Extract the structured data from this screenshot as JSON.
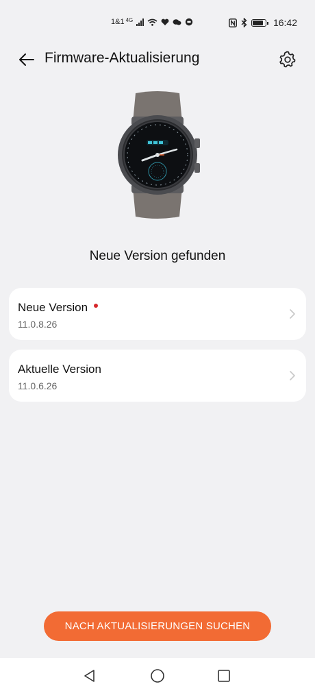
{
  "status_bar": {
    "left_text": "1&1",
    "network": "4G",
    "time": "16:42",
    "battery_level": 0.85,
    "icons_left": [
      "signal-icon",
      "wifi-icon",
      "heart-icon",
      "chat-icon",
      "message-icon"
    ],
    "icons_right": [
      "nfc-icon",
      "bluetooth-icon",
      "battery-icon"
    ]
  },
  "header": {
    "title": "Firmware-Aktualisierung",
    "back_icon": "arrow-left-icon",
    "settings_icon": "gear-icon"
  },
  "device": {
    "image": "smartwatch-image"
  },
  "status_message": "Neue Version gefunden",
  "versions": [
    {
      "label": "Neue Version",
      "version": "11.0.8.26",
      "has_new_indicator": true
    },
    {
      "label": "Aktuelle Version",
      "version": "11.0.6.26",
      "has_new_indicator": false
    }
  ],
  "actions": {
    "check_updates_label": "NACH AKTUALISIERUNGEN SUCHEN"
  },
  "colors": {
    "accent": "#f26b34",
    "background": "#f1f1f3",
    "indicator": "#d6282c"
  }
}
